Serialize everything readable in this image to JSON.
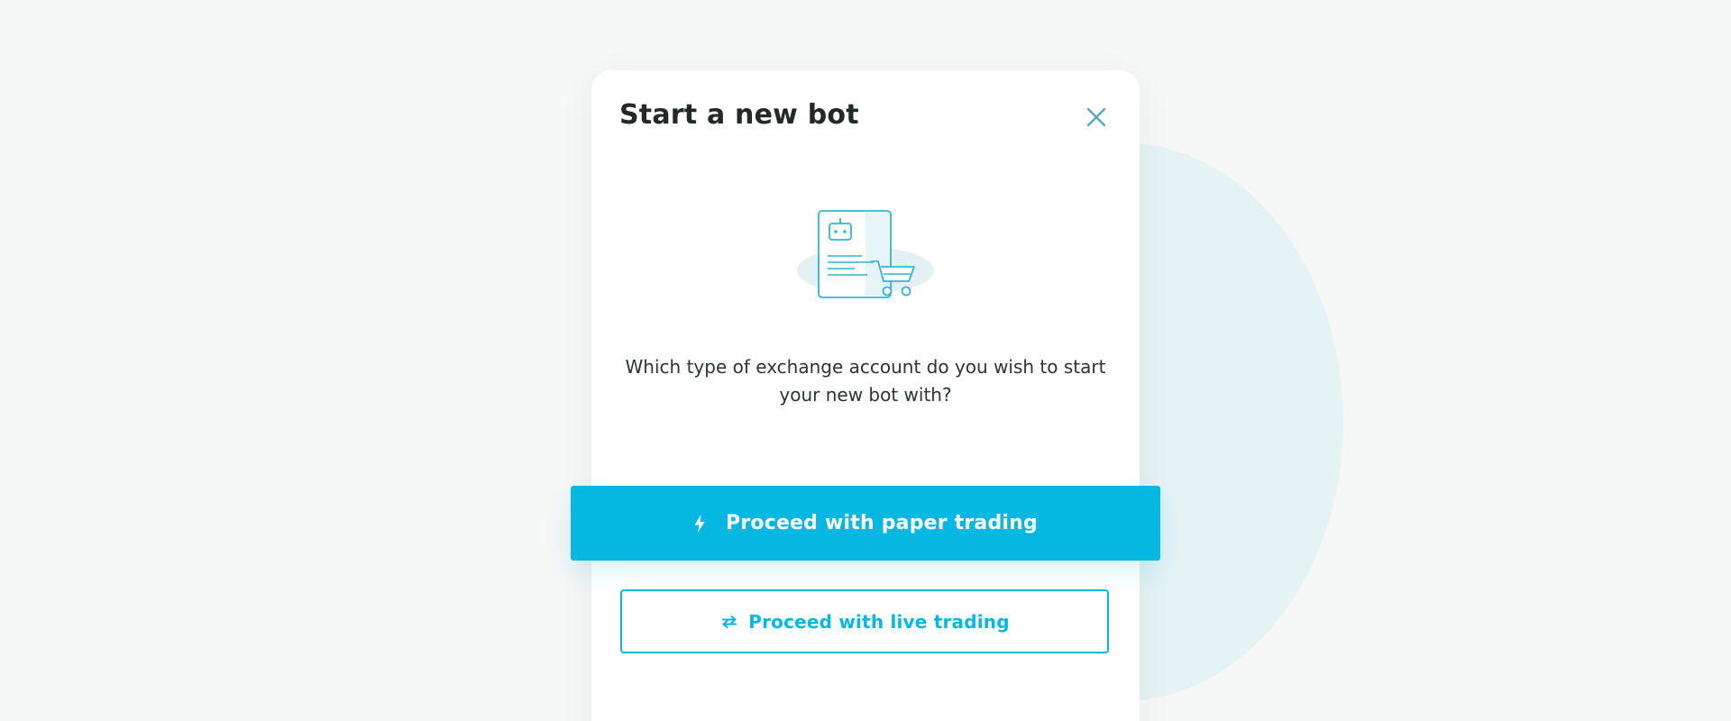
{
  "modal": {
    "title": "Start a new bot",
    "question": "Which type of exchange account do you wish to start your new bot with?",
    "close_icon": "close-icon",
    "illustration_icon": "bot-shopping-cart-illustration"
  },
  "actions": {
    "paper": {
      "label": "Proceed with paper trading",
      "icon": "lightning-bolt-icon"
    },
    "live": {
      "label": "Proceed with live trading",
      "icon": "exchange-arrows-icon"
    }
  },
  "colors": {
    "accent": "#06b8e1",
    "background": "#f6f7f7",
    "circle": "#e6f3f5",
    "title": "#22292b",
    "close_icon": "#5aa6b2"
  }
}
